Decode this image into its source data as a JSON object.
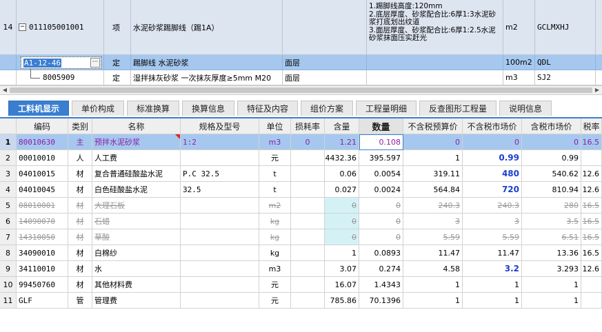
{
  "top_rows": [
    {
      "num": "14",
      "code": "011105001001",
      "type": "项",
      "name": "水泥砂浆踢脚线（踢1A）",
      "spec": "",
      "feature": "1.踢脚线高度:120mm\n2.底层厚度、砂浆配合比:6厚1:3水泥砂浆打底划出纹道\n3.面层厚度、砂浆配合比:6厚1:2.5水泥砂浆抹面压实赶光",
      "unit": "m2",
      "expr": "GCLMXHJ"
    },
    {
      "num": "",
      "code": "A1-12-46",
      "type": "定",
      "name": "踢脚线 水泥砂浆",
      "spec": "面层",
      "feature": "",
      "unit": "100m2",
      "expr": "QDL"
    },
    {
      "num": "",
      "code": "8005909",
      "type": "定",
      "name": "湿拌抹灰砂浆 一次抹灰厚度≥5mm M20",
      "spec": "面层",
      "feature": "",
      "unit": "m3",
      "expr": "SJ2"
    }
  ],
  "dots_label": "···",
  "toggle_label": "−",
  "tabs": [
    "工料机显示",
    "单价构成",
    "标准换算",
    "换算信息",
    "特征及内容",
    "组价方案",
    "工程量明细",
    "反查图形工程量",
    "说明信息"
  ],
  "headers": [
    "编码",
    "类别",
    "名称",
    "规格及型号",
    "单位",
    "损耗率",
    "含量",
    "数量",
    "不含税预算价",
    "不含税市场价",
    "含税市场价",
    "税率"
  ],
  "rows": [
    {
      "n": "1",
      "code": "80010630",
      "cat": "主",
      "name": "预拌水泥砂浆",
      "spec": "1:2",
      "unit": "m3",
      "loss": "0",
      "content": "1.21",
      "qty": "0.108",
      "budget": "0",
      "market": "0",
      "taxed": "0",
      "rate": "16.5"
    },
    {
      "n": "2",
      "code": "00010010",
      "cat": "人",
      "name": "人工费",
      "spec": "",
      "unit": "元",
      "loss": "",
      "content": "4432.36",
      "qty": "395.597",
      "budget": "1",
      "market": "0.99",
      "taxed": "0.99",
      "rate": ""
    },
    {
      "n": "3",
      "code": "04010015",
      "cat": "材",
      "name": "复合普通硅酸盐水泥",
      "spec": "P.C 32.5",
      "unit": "t",
      "loss": "",
      "content": "0.06",
      "qty": "0.0054",
      "budget": "319.11",
      "market": "480",
      "taxed": "540.62",
      "rate": "12.6"
    },
    {
      "n": "4",
      "code": "04010045",
      "cat": "材",
      "name": "白色硅酸盐水泥",
      "spec": "32.5",
      "unit": "t",
      "loss": "",
      "content": "0.027",
      "qty": "0.0024",
      "budget": "564.84",
      "market": "720",
      "taxed": "810.94",
      "rate": "12.6"
    },
    {
      "n": "5",
      "code": "08010001",
      "cat": "材",
      "name": "大理石板",
      "spec": "",
      "unit": "m2",
      "loss": "",
      "content": "0",
      "qty": "0",
      "budget": "240.3",
      "market": "240.3",
      "taxed": "280",
      "rate": "16.5"
    },
    {
      "n": "6",
      "code": "14090070",
      "cat": "材",
      "name": "石蜡",
      "spec": "",
      "unit": "kg",
      "loss": "",
      "content": "0",
      "qty": "0",
      "budget": "3",
      "market": "3",
      "taxed": "3.5",
      "rate": "16.5"
    },
    {
      "n": "7",
      "code": "14310050",
      "cat": "材",
      "name": "草酸",
      "spec": "",
      "unit": "kg",
      "loss": "",
      "content": "0",
      "qty": "0",
      "budget": "5.59",
      "market": "5.59",
      "taxed": "6.51",
      "rate": "16.5"
    },
    {
      "n": "8",
      "code": "34090010",
      "cat": "材",
      "name": "白棉纱",
      "spec": "",
      "unit": "kg",
      "loss": "",
      "content": "1",
      "qty": "0.0893",
      "budget": "11.47",
      "market": "11.47",
      "taxed": "13.36",
      "rate": "16.5"
    },
    {
      "n": "9",
      "code": "34110010",
      "cat": "材",
      "name": "水",
      "spec": "",
      "unit": "m3",
      "loss": "",
      "content": "3.07",
      "qty": "0.274",
      "budget": "4.58",
      "market": "3.2",
      "taxed": "3.293",
      "rate": "12.6"
    },
    {
      "n": "10",
      "code": "99450760",
      "cat": "材",
      "name": "其他材料费",
      "spec": "",
      "unit": "元",
      "loss": "",
      "content": "16.07",
      "qty": "1.4343",
      "budget": "1",
      "market": "1",
      "taxed": "1",
      "rate": ""
    },
    {
      "n": "11",
      "code": "GLF",
      "cat": "管",
      "name": "管理费",
      "spec": "",
      "unit": "元",
      "loss": "",
      "content": "785.86",
      "qty": "70.1396",
      "budget": "1",
      "market": "1",
      "taxed": "1",
      "rate": ""
    }
  ],
  "colors": {
    "accent": "#3a7ed0",
    "selected_row": "#a6c8ef",
    "market_highlight": "#1a3fcf",
    "strike_text": "#9a9a9a",
    "readonly_cell": "#d4f2f6"
  }
}
